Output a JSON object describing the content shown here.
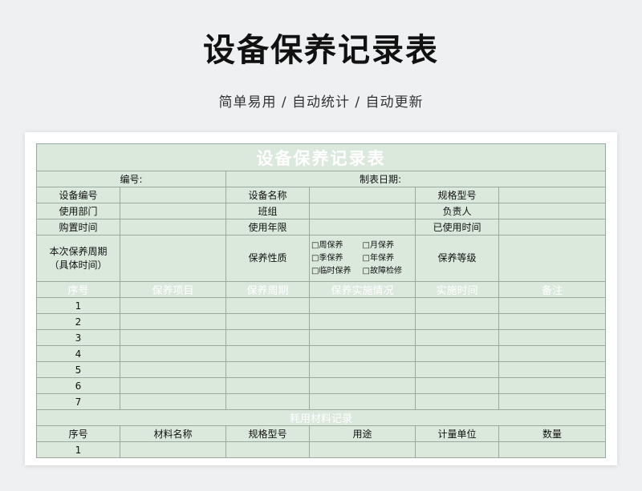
{
  "header": {
    "title": "设备保养记录表",
    "subtitle": "简单易用 / 自动统计 / 自动更新"
  },
  "sheet": {
    "title": "设备保养记录表",
    "number_label": "编号:",
    "date_label": "制表日期:",
    "info_rows": [
      [
        "设备编号",
        "设备名称",
        "规格型号"
      ],
      [
        "使用部门",
        "班组",
        "负责人"
      ],
      [
        "购置时间",
        "使用年限",
        "已使用时间"
      ]
    ],
    "period_label_1": "本次保养周期",
    "period_label_2": "（具体时间）",
    "nature_label": "保养性质",
    "nature_options": [
      "□周保养",
      "□月保养",
      "□季保养",
      "□年保养",
      "□临时保养",
      "□故障检修"
    ],
    "grade_label": "保养等级",
    "columns": [
      "序号",
      "保养项目",
      "保养周期",
      "保养实施情况",
      "实施时间",
      "备注"
    ],
    "rows": [
      "1",
      "2",
      "3",
      "4",
      "5",
      "6",
      "7"
    ],
    "materials_title": "耗用材料记录",
    "material_columns": [
      "序号",
      "材料名称",
      "规格型号",
      "用途",
      "计量单位",
      "数量"
    ],
    "material_rows": [
      "1"
    ]
  }
}
